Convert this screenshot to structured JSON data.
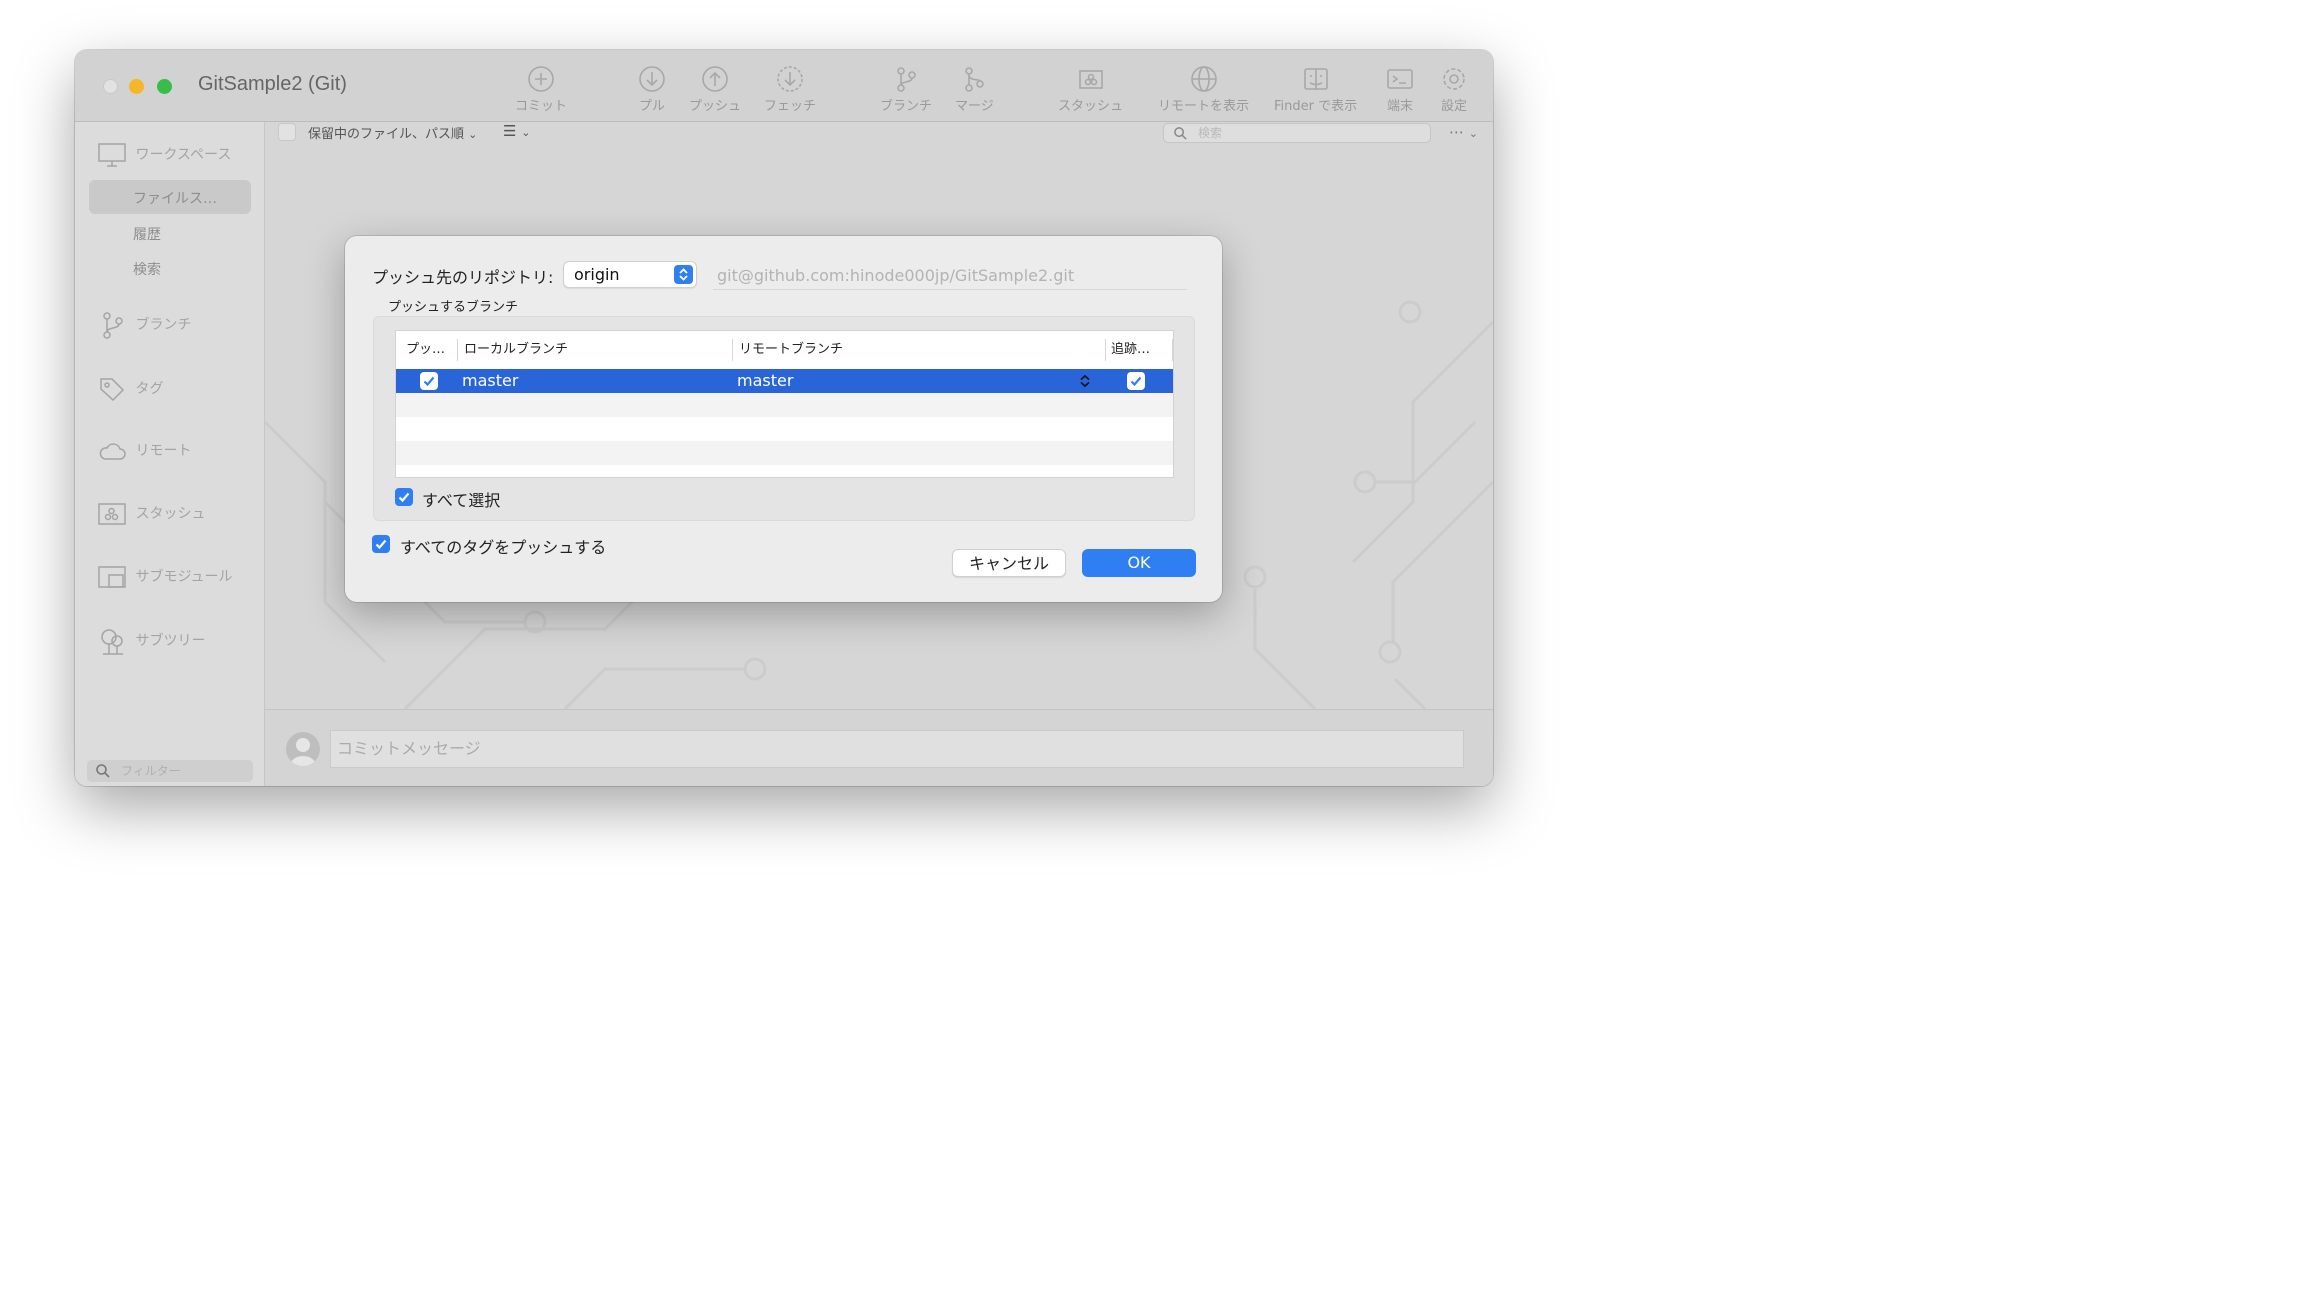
{
  "window": {
    "title": "GitSample2 (Git)"
  },
  "toolbar": {
    "items": [
      {
        "label": "コミット",
        "icon": "plus-circle-icon"
      },
      {
        "label": "プル",
        "icon": "arrow-down-circle-icon"
      },
      {
        "label": "プッシュ",
        "icon": "arrow-up-circle-icon"
      },
      {
        "label": "フェッチ",
        "icon": "dashed-arrow-down-circle-icon"
      },
      {
        "label": "ブランチ",
        "icon": "branch-icon"
      },
      {
        "label": "マージ",
        "icon": "merge-icon"
      },
      {
        "label": "スタッシュ",
        "icon": "stash-icon"
      },
      {
        "label": "リモートを表示",
        "icon": "globe-icon"
      },
      {
        "label": "Finder で表示",
        "icon": "finder-icon"
      },
      {
        "label": "端末",
        "icon": "terminal-icon"
      },
      {
        "label": "設定",
        "icon": "gear-icon"
      }
    ]
  },
  "sidebar": {
    "workspace": "ワークスペース",
    "sub_items": [
      "ファイルス…",
      "履歴",
      "検索"
    ],
    "sections": [
      "ブランチ",
      "タグ",
      "リモート",
      "スタッシュ",
      "サブモジュール",
      "サブツリー"
    ],
    "filter_placeholder": "フィルター"
  },
  "main": {
    "file_filter": "保留中のファイル、パス順",
    "search_placeholder": "検索",
    "commit_placeholder": "コミットメッセージ"
  },
  "dialog": {
    "repo_label": "プッシュ先のリポジトリ:",
    "repo_value": "origin",
    "repo_url": "git@github.com:hinode000jp/GitSample2.git",
    "branch_group_label": "プッシュするブランチ",
    "columns": [
      "プッ…",
      "ローカルブランチ",
      "リモートブランチ",
      "追跡…"
    ],
    "rows": [
      {
        "push": true,
        "local": "master",
        "remote": "master",
        "track": true
      }
    ],
    "select_all_label": "すべて選択",
    "select_all_checked": true,
    "push_tags_label": "すべてのタグをプッシュする",
    "push_tags_checked": true,
    "cancel_label": "キャンセル",
    "ok_label": "OK"
  },
  "colors": {
    "accent": "#2f7ff2",
    "selection": "#2964d9"
  }
}
